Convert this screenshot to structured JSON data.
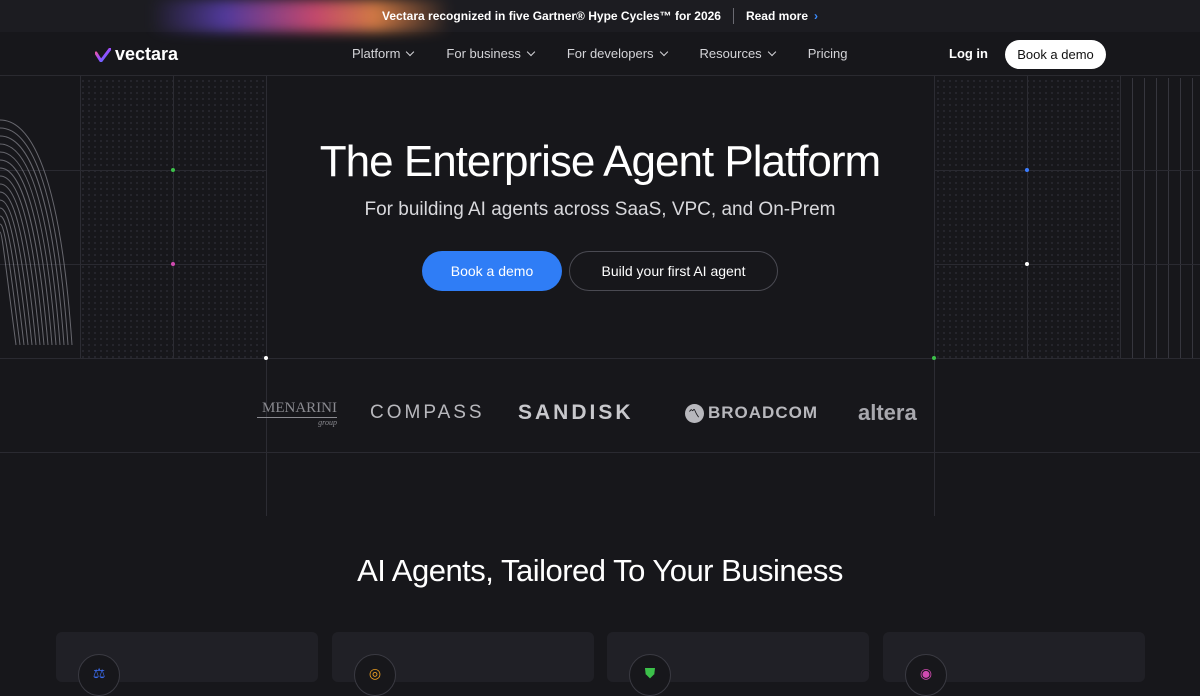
{
  "announcement": {
    "text": "Vectara recognized in five Gartner® Hype Cycles™ for 2026",
    "link": "Read more",
    "link_icon": "chevron-right-icon"
  },
  "nav": {
    "logo_text": "vectara",
    "items": [
      {
        "label": "Platform",
        "icon": "chevron-down-icon"
      },
      {
        "label": "For business",
        "icon": "chevron-down-icon"
      },
      {
        "label": "For developers",
        "icon": "chevron-down-icon"
      },
      {
        "label": "Resources",
        "icon": "chevron-down-icon"
      },
      {
        "label": "Pricing"
      }
    ],
    "login": "Log in",
    "demo": "Book a demo"
  },
  "hero": {
    "title": "The Enterprise Agent Platform",
    "subtitle": "For building AI agents across SaaS, VPC, and On-Prem",
    "primary_cta": "Book a demo",
    "secondary_cta": "Build your first AI agent"
  },
  "customers": {
    "menarini": {
      "name": "MENARINI",
      "tag": "group"
    },
    "compass": "COMPASS",
    "sandisk": "SANDISK",
    "broadcom": "BROADCOM",
    "altera": "altera"
  },
  "section": {
    "title": "AI Agents, Tailored To Your Business"
  },
  "cards": [
    {
      "icon": "scales-icon",
      "color": "#3b6cf0"
    },
    {
      "icon": "target-icon",
      "color": "#f0a020"
    },
    {
      "icon": "shield-icon",
      "color": "#3cc04a"
    },
    {
      "icon": "fingerprint-icon",
      "color": "#d04ab0"
    }
  ],
  "colors": {
    "accent": "#2f7df6",
    "background": "#17171b"
  }
}
